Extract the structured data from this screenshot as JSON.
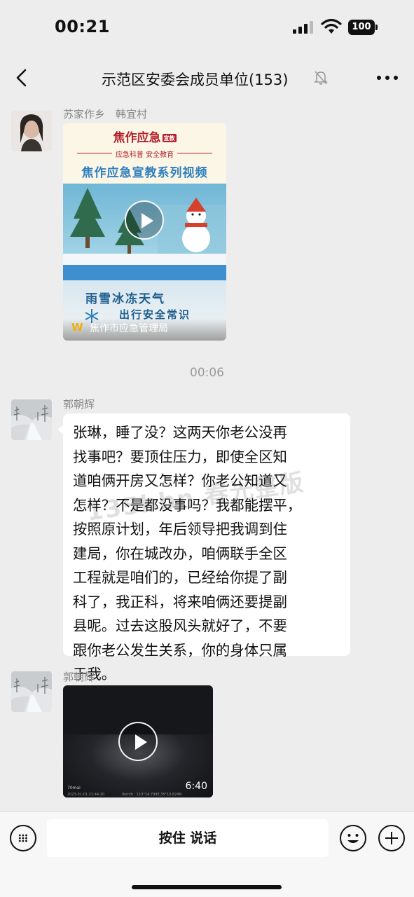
{
  "status_bar": {
    "time": "00:21",
    "battery": "100",
    "icons": [
      "signal-icon",
      "wifi-icon",
      "battery-icon"
    ]
  },
  "header": {
    "title": "示范区安委会成员单位(153)",
    "icons": [
      "back-icon",
      "mute-icon",
      "more-icon"
    ]
  },
  "messages": [
    {
      "sender": "苏家作乡　韩宜村",
      "type": "video-card",
      "card": {
        "logo": "焦作应急",
        "logo_tag": "宣教",
        "slogan": "应急科普 安全教育",
        "series": "焦作应急宣教系列视频",
        "headline": "雨雪冰冻天气",
        "subheadline": "出行安全常识",
        "source": "焦作市应急管理局"
      }
    },
    {
      "type": "timestamp",
      "time": "00:06"
    },
    {
      "sender": "郭朝辉",
      "type": "text",
      "text": "张琳，睡了没？这两天你老公没再找事吧？要顶住压力，即使全区知道咱俩开房又怎样？你老公知道又怎样？不是都没事吗？我都能摆平，按照原计划，年后领导把我调到住建局，你在城改办，咱俩联手全区工程就是咱们的，已经给你提了副科了，我正科，将来咱俩还要提副县吧。过去这股风头就好了，不要跟你老公发生关系，你的身体只属于我。",
      "text_lines": [
        "张琳，睡了没？这两天你老公没再",
        "找事吧？要顶住压力，即使全区知",
        "道咱俩开房又怎样？你老公知道又",
        "怎样？不是都没事吗？我都能摆平，",
        "按照原计划，年后领导把我调到住",
        "建局，你在城改办，咱俩联手全区",
        "工程就是咱们的，已经给你提了副",
        "科了，我正科，将来咱俩还要提副",
        "县呢。过去这股风头就好了，不要",
        "跟你老公发生关系，你的身体只属",
        "于我。"
      ]
    },
    {
      "sender": "郭朝辉",
      "type": "video",
      "duration": "6:40",
      "brand": "70mai",
      "meta": "2023-01-01 21:44:20　　　　　0km/h　113°14.799E,35°10.824N"
    }
  ],
  "watermark": "135bbn 春光整版",
  "input_bar": {
    "hold_to_talk": "按住 说话",
    "icons": [
      "voice-icon",
      "emoji-icon",
      "plus-icon"
    ]
  }
}
